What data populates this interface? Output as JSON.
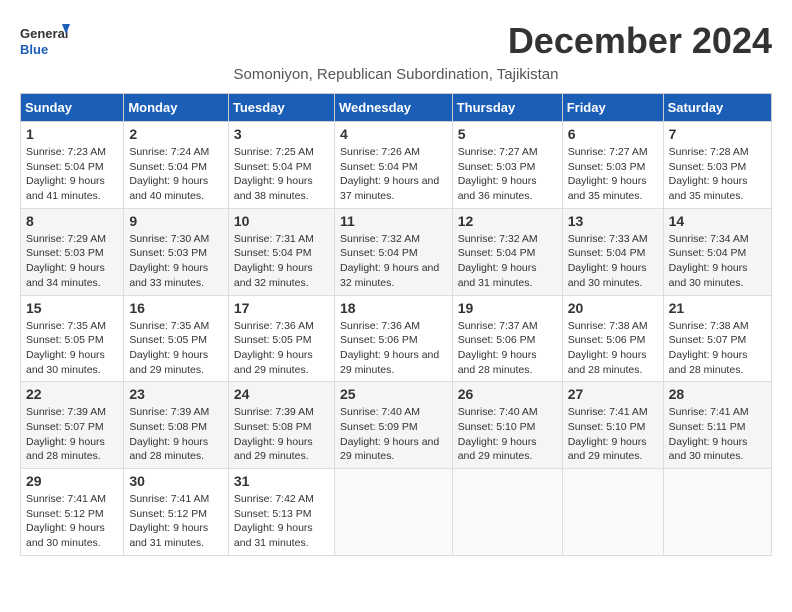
{
  "header": {
    "logo_general": "General",
    "logo_blue": "Blue",
    "title": "December 2024",
    "subtitle": "Somoniyon, Republican Subordination, Tajikistan"
  },
  "columns": [
    "Sunday",
    "Monday",
    "Tuesday",
    "Wednesday",
    "Thursday",
    "Friday",
    "Saturday"
  ],
  "weeks": [
    [
      {
        "day": "1",
        "sunrise": "7:23 AM",
        "sunset": "5:04 PM",
        "daylight": "9 hours and 41 minutes."
      },
      {
        "day": "2",
        "sunrise": "7:24 AM",
        "sunset": "5:04 PM",
        "daylight": "9 hours and 40 minutes."
      },
      {
        "day": "3",
        "sunrise": "7:25 AM",
        "sunset": "5:04 PM",
        "daylight": "9 hours and 38 minutes."
      },
      {
        "day": "4",
        "sunrise": "7:26 AM",
        "sunset": "5:04 PM",
        "daylight": "9 hours and 37 minutes."
      },
      {
        "day": "5",
        "sunrise": "7:27 AM",
        "sunset": "5:03 PM",
        "daylight": "9 hours and 36 minutes."
      },
      {
        "day": "6",
        "sunrise": "7:27 AM",
        "sunset": "5:03 PM",
        "daylight": "9 hours and 35 minutes."
      },
      {
        "day": "7",
        "sunrise": "7:28 AM",
        "sunset": "5:03 PM",
        "daylight": "9 hours and 35 minutes."
      }
    ],
    [
      {
        "day": "8",
        "sunrise": "7:29 AM",
        "sunset": "5:03 PM",
        "daylight": "9 hours and 34 minutes."
      },
      {
        "day": "9",
        "sunrise": "7:30 AM",
        "sunset": "5:03 PM",
        "daylight": "9 hours and 33 minutes."
      },
      {
        "day": "10",
        "sunrise": "7:31 AM",
        "sunset": "5:04 PM",
        "daylight": "9 hours and 32 minutes."
      },
      {
        "day": "11",
        "sunrise": "7:32 AM",
        "sunset": "5:04 PM",
        "daylight": "9 hours and 32 minutes."
      },
      {
        "day": "12",
        "sunrise": "7:32 AM",
        "sunset": "5:04 PM",
        "daylight": "9 hours and 31 minutes."
      },
      {
        "day": "13",
        "sunrise": "7:33 AM",
        "sunset": "5:04 PM",
        "daylight": "9 hours and 30 minutes."
      },
      {
        "day": "14",
        "sunrise": "7:34 AM",
        "sunset": "5:04 PM",
        "daylight": "9 hours and 30 minutes."
      }
    ],
    [
      {
        "day": "15",
        "sunrise": "7:35 AM",
        "sunset": "5:05 PM",
        "daylight": "9 hours and 30 minutes."
      },
      {
        "day": "16",
        "sunrise": "7:35 AM",
        "sunset": "5:05 PM",
        "daylight": "9 hours and 29 minutes."
      },
      {
        "day": "17",
        "sunrise": "7:36 AM",
        "sunset": "5:05 PM",
        "daylight": "9 hours and 29 minutes."
      },
      {
        "day": "18",
        "sunrise": "7:36 AM",
        "sunset": "5:06 PM",
        "daylight": "9 hours and 29 minutes."
      },
      {
        "day": "19",
        "sunrise": "7:37 AM",
        "sunset": "5:06 PM",
        "daylight": "9 hours and 28 minutes."
      },
      {
        "day": "20",
        "sunrise": "7:38 AM",
        "sunset": "5:06 PM",
        "daylight": "9 hours and 28 minutes."
      },
      {
        "day": "21",
        "sunrise": "7:38 AM",
        "sunset": "5:07 PM",
        "daylight": "9 hours and 28 minutes."
      }
    ],
    [
      {
        "day": "22",
        "sunrise": "7:39 AM",
        "sunset": "5:07 PM",
        "daylight": "9 hours and 28 minutes."
      },
      {
        "day": "23",
        "sunrise": "7:39 AM",
        "sunset": "5:08 PM",
        "daylight": "9 hours and 28 minutes."
      },
      {
        "day": "24",
        "sunrise": "7:39 AM",
        "sunset": "5:08 PM",
        "daylight": "9 hours and 29 minutes."
      },
      {
        "day": "25",
        "sunrise": "7:40 AM",
        "sunset": "5:09 PM",
        "daylight": "9 hours and 29 minutes."
      },
      {
        "day": "26",
        "sunrise": "7:40 AM",
        "sunset": "5:10 PM",
        "daylight": "9 hours and 29 minutes."
      },
      {
        "day": "27",
        "sunrise": "7:41 AM",
        "sunset": "5:10 PM",
        "daylight": "9 hours and 29 minutes."
      },
      {
        "day": "28",
        "sunrise": "7:41 AM",
        "sunset": "5:11 PM",
        "daylight": "9 hours and 30 minutes."
      }
    ],
    [
      {
        "day": "29",
        "sunrise": "7:41 AM",
        "sunset": "5:12 PM",
        "daylight": "9 hours and 30 minutes."
      },
      {
        "day": "30",
        "sunrise": "7:41 AM",
        "sunset": "5:12 PM",
        "daylight": "9 hours and 31 minutes."
      },
      {
        "day": "31",
        "sunrise": "7:42 AM",
        "sunset": "5:13 PM",
        "daylight": "9 hours and 31 minutes."
      },
      null,
      null,
      null,
      null
    ]
  ]
}
